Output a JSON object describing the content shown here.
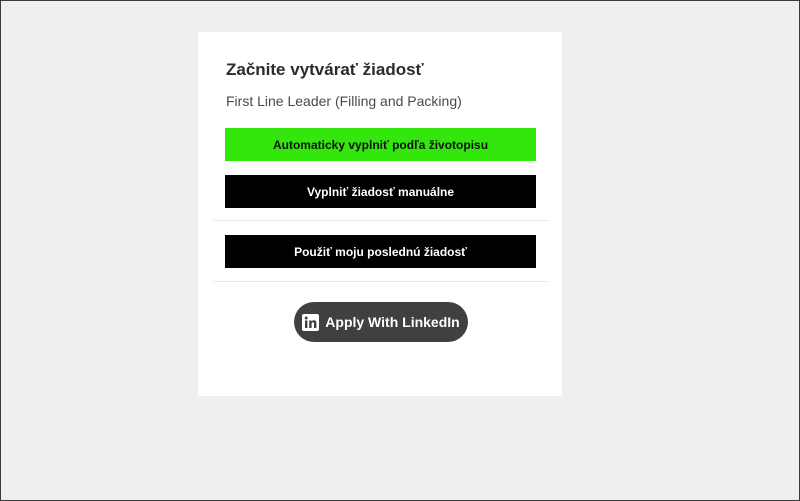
{
  "card": {
    "title": "Začnite vytvárať žiadosť",
    "job_title": "First Line Leader (Filling and Packing)"
  },
  "actions": {
    "autofill_label": "Automaticky vyplniť podľa životopisu",
    "manual_label": "Vyplniť žiadosť manuálne",
    "last_application_label": "Použiť moju poslednú žiadosť"
  },
  "linkedin": {
    "label": "Apply With LinkedIn",
    "icon": "linkedin-icon"
  },
  "colors": {
    "page_background": "#eeeff1",
    "card_background": "#ffffff",
    "autofill_button": "#33e70c",
    "primary_button": "#000000",
    "linkedin_button": "#404040"
  }
}
